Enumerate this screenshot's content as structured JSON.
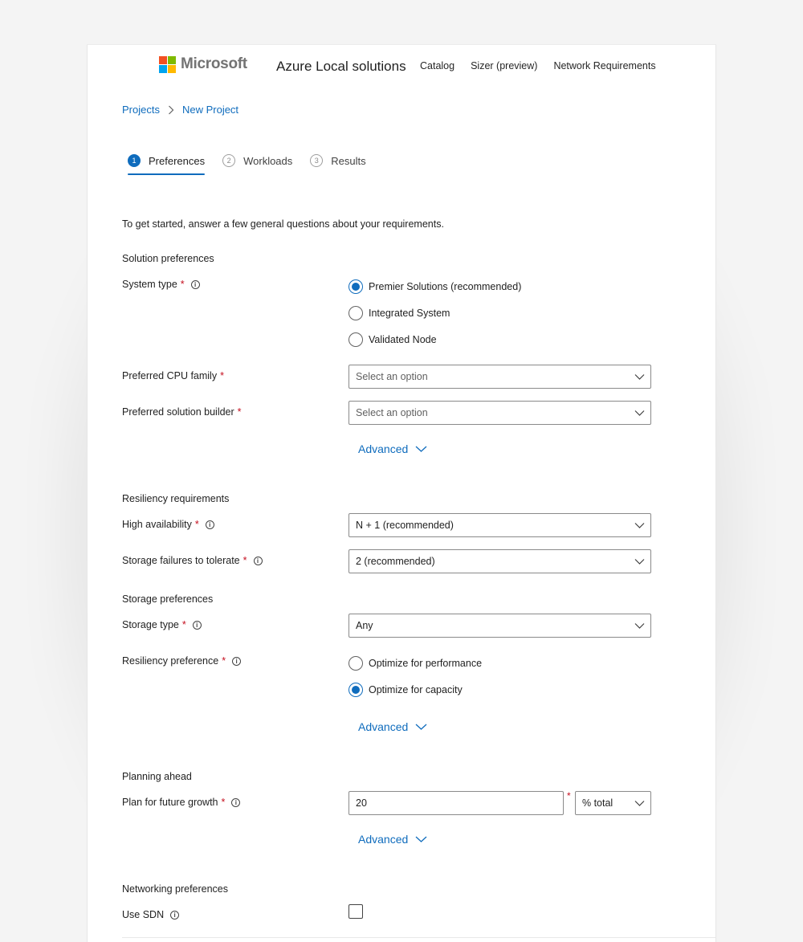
{
  "header": {
    "brand": "Microsoft",
    "app_title": "Azure Local solutions",
    "nav": [
      "Catalog",
      "Sizer (preview)",
      "Network Requirements"
    ],
    "brand_colors": [
      "#f25022",
      "#7fba00",
      "#00a4ef",
      "#ffb900"
    ]
  },
  "breadcrumb": {
    "items": [
      "Projects",
      "New Project"
    ]
  },
  "steps": [
    {
      "num": "1",
      "label": "Preferences",
      "active": true
    },
    {
      "num": "2",
      "label": "Workloads",
      "active": false
    },
    {
      "num": "3",
      "label": "Results",
      "active": false
    }
  ],
  "intro": "To get started, answer a few general questions about your requirements.",
  "required_mark": "*",
  "info_glyph": "i",
  "solution": {
    "title": "Solution preferences",
    "system_type_label": "System type",
    "system_type_options": [
      {
        "label": "Premier Solutions (recommended)",
        "checked": true
      },
      {
        "label": "Integrated System",
        "checked": false
      },
      {
        "label": "Validated Node",
        "checked": false
      }
    ],
    "cpu_label": "Preferred CPU family",
    "cpu_value": "Select an option",
    "builder_label": "Preferred solution builder",
    "builder_value": "Select an option",
    "advanced": "Advanced"
  },
  "resiliency": {
    "title": "Resiliency requirements",
    "ha_label": "High availability",
    "ha_value": "N + 1 (recommended)",
    "failures_label": "Storage failures to tolerate",
    "failures_value": "2 (recommended)"
  },
  "storage": {
    "title": "Storage preferences",
    "type_label": "Storage type",
    "type_value": "Any",
    "resiliency_label": "Resiliency preference",
    "resiliency_options": [
      {
        "label": "Optimize for performance",
        "checked": false
      },
      {
        "label": "Optimize for capacity",
        "checked": true
      }
    ],
    "advanced": "Advanced"
  },
  "planning": {
    "title": "Planning ahead",
    "growth_label": "Plan for future growth",
    "growth_value": "20",
    "unit_value": "% total",
    "advanced": "Advanced"
  },
  "networking": {
    "title": "Networking preferences",
    "sdn_label": "Use SDN",
    "sdn_checked": false
  },
  "accent_color": "#0f6cbd",
  "required_color": "#c50f1f"
}
